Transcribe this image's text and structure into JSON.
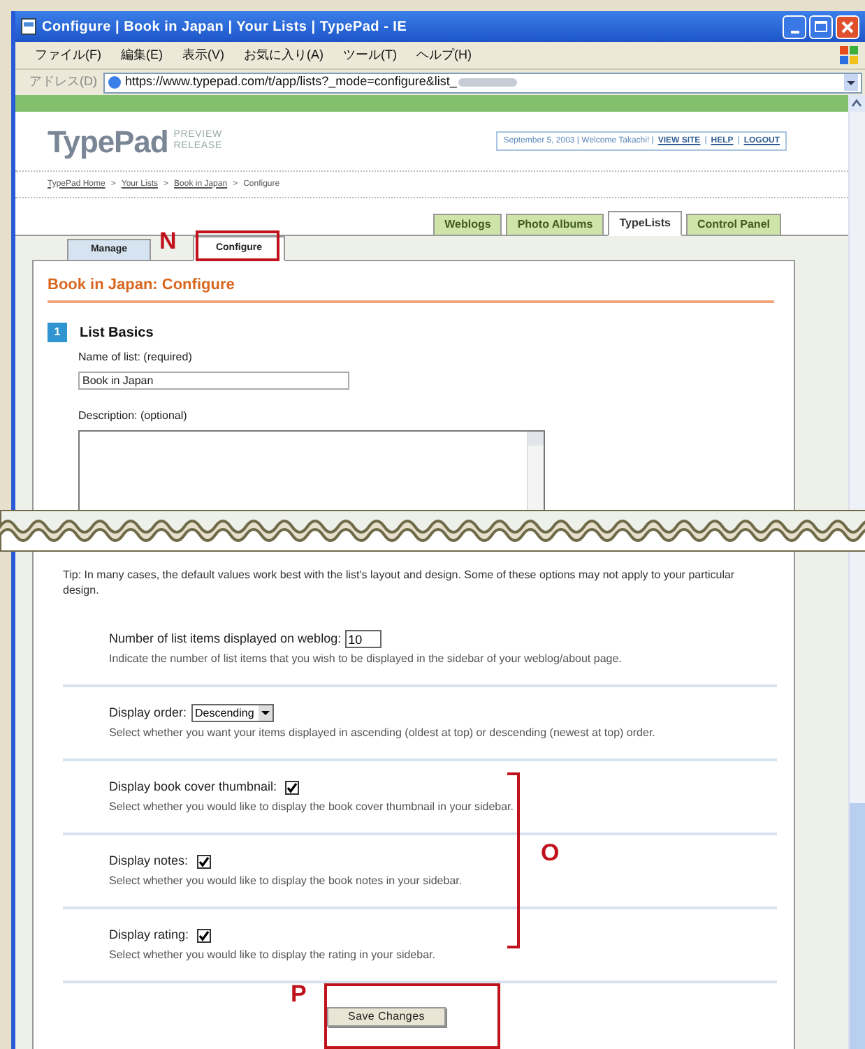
{
  "window": {
    "title": "Configure | Book in Japan | Your Lists | TypePad - IE"
  },
  "menu": [
    "ファイル(F)",
    "編集(E)",
    "表示(V)",
    "お気に入り(A)",
    "ツール(T)",
    "ヘルプ(H)"
  ],
  "address": {
    "label": "アドレス(D)",
    "url": "https://www.typepad.com/t/app/lists?_mode=configure&list_"
  },
  "header": {
    "logo": "TypePad",
    "logo_badge": "PREVIEW RELEASE",
    "info": "September 5, 2003 | Welcome Takachi! |",
    "links": [
      "VIEW SITE",
      "HELP",
      "LOGOUT"
    ]
  },
  "breadcrumb": [
    {
      "label": "TypePad Home",
      "link": true
    },
    {
      "label": "Your Lists",
      "link": true
    },
    {
      "label": "Book in Japan",
      "link": true
    },
    {
      "label": "Configure",
      "link": false
    }
  ],
  "breadcrumb_separator": ">",
  "link_separator": "|",
  "main_tabs": [
    {
      "label": "Weblogs",
      "selected": false
    },
    {
      "label": "Photo Albums",
      "selected": false
    },
    {
      "label": "TypeLists",
      "selected": true
    },
    {
      "label": "Control Panel",
      "selected": false
    }
  ],
  "sub_tabs": [
    {
      "label": "Manage",
      "selected": false
    },
    {
      "label": "Configure",
      "selected": true
    }
  ],
  "page_title": "Book in Japan: Configure",
  "section": {
    "number": "1",
    "title": "List Basics"
  },
  "name_field": {
    "label": "Name of list: (required)",
    "value": "Book in Japan"
  },
  "description_field": {
    "label": "Description: (optional)"
  },
  "tip": "Tip: In many cases, the default values work best with the list's layout and design. Some of these options may not apply to your particular design.",
  "options": [
    {
      "kind": "number",
      "label": "Number of list items displayed on weblog:",
      "value": "10",
      "help": "Indicate the number of list items that you wish to be displayed in the sidebar of your weblog/about page."
    },
    {
      "kind": "select",
      "label": "Display order:",
      "value": "Descending",
      "help": "Select whether you want your items displayed in ascending (oldest at top) or descending (newest at top) order."
    },
    {
      "kind": "checkbox",
      "label": "Display book cover thumbnail:",
      "checked": true,
      "help": "Select whether you would like to display the book cover thumbnail in your sidebar."
    },
    {
      "kind": "checkbox",
      "label": "Display notes:",
      "checked": true,
      "help": "Select whether you would like to display the book notes in your sidebar."
    },
    {
      "kind": "checkbox",
      "label": "Display rating:",
      "checked": true,
      "help": "Select whether you would like to display the rating in your sidebar."
    }
  ],
  "save_button": "Save Changes",
  "callouts": {
    "configure_tab": "N",
    "checkbox_options": "O",
    "save_button": "P"
  }
}
